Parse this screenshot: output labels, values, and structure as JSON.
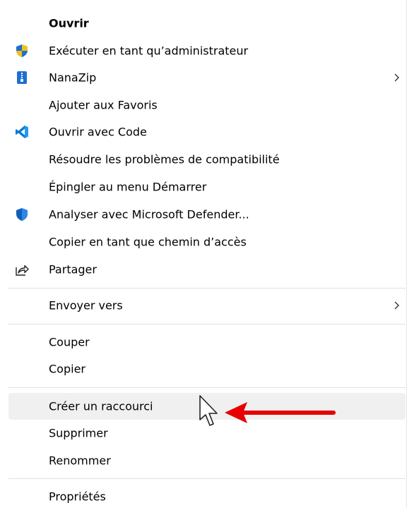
{
  "menu": {
    "items": [
      {
        "label": "Ouvrir",
        "icon": null
      },
      {
        "label": "Exécuter en tant qu’administrateur",
        "icon": "shield-uac-icon"
      },
      {
        "label": "NanaZip",
        "icon": "nanazip-icon"
      },
      {
        "label": "Ajouter aux Favoris",
        "icon": null
      },
      {
        "label": "Ouvrir avec Code",
        "icon": "vscode-icon"
      },
      {
        "label": "Résoudre les problèmes de compatibilité",
        "icon": null
      },
      {
        "label": "Épingler au menu Démarrer",
        "icon": null
      },
      {
        "label": "Analyser avec Microsoft Defender...",
        "icon": "defender-icon"
      },
      {
        "label": "Copier en tant que chemin d’accès",
        "icon": null
      },
      {
        "label": "Partager",
        "icon": "share-icon"
      },
      {
        "label": "Envoyer vers",
        "icon": null
      },
      {
        "label": "Couper",
        "icon": null
      },
      {
        "label": "Copier",
        "icon": null
      },
      {
        "label": "Créer un raccourci",
        "icon": null
      },
      {
        "label": "Supprimer",
        "icon": null
      },
      {
        "label": "Renommer",
        "icon": null
      },
      {
        "label": "Propriétés",
        "icon": null
      }
    ]
  },
  "colors": {
    "hover": "#f0f0f0",
    "separator": "#e1e1e1",
    "annotation_arrow": "#e60000"
  }
}
